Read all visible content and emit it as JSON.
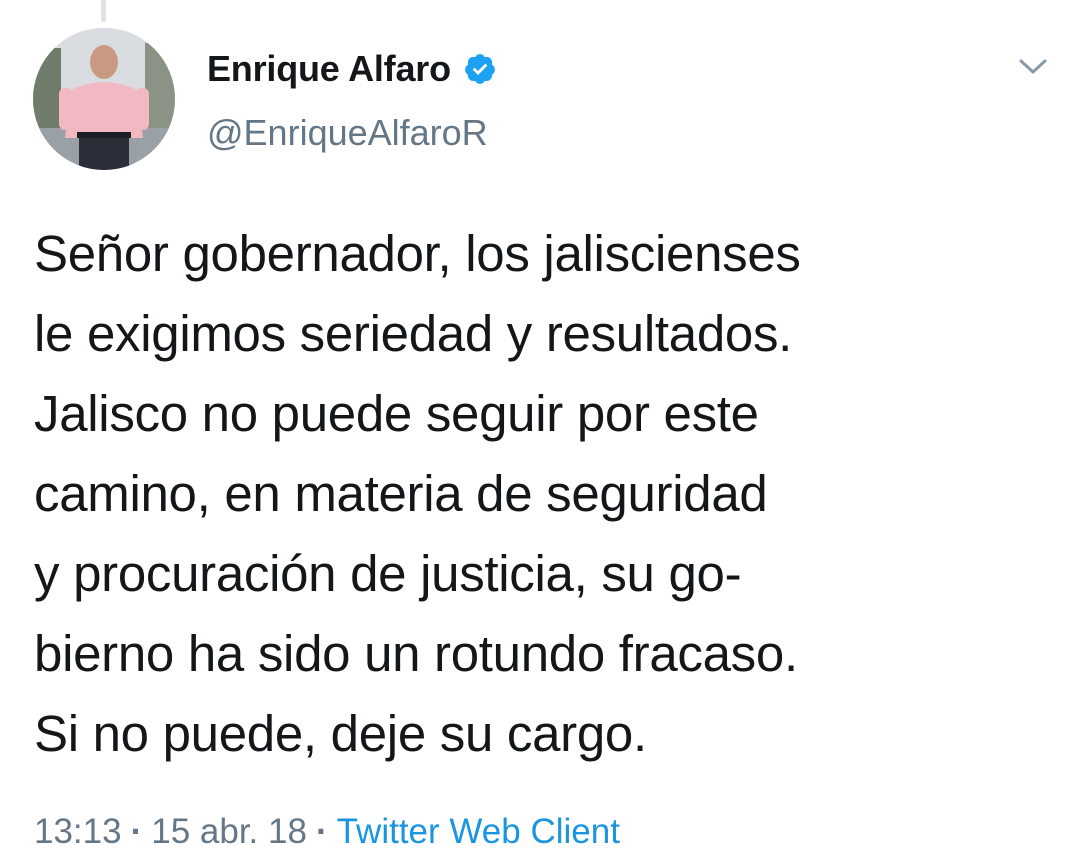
{
  "tweet": {
    "author": {
      "display_name": "Enrique Alfaro",
      "handle": "@EnriqueAlfaroR",
      "verified": true,
      "avatar_icon": "profile-photo"
    },
    "text": "Señor gobernador, los jaliscienses\nle exigimos seriedad y resultados.\nJalisco no puede seguir por este\ncamino, en materia de seguridad\ny procuración de justicia, su go-\nbierno ha sido un rotundo fracaso.\nSi no puede, deje su cargo.",
    "time": "13:13",
    "date": "15 abr. 18",
    "separator": "·",
    "source": "Twitter Web Client",
    "menu_icon": "chevron-down-icon"
  },
  "colors": {
    "text": "#14171a",
    "secondary": "#657786",
    "link": "#1b95e0",
    "verified": "#1da1f2"
  }
}
